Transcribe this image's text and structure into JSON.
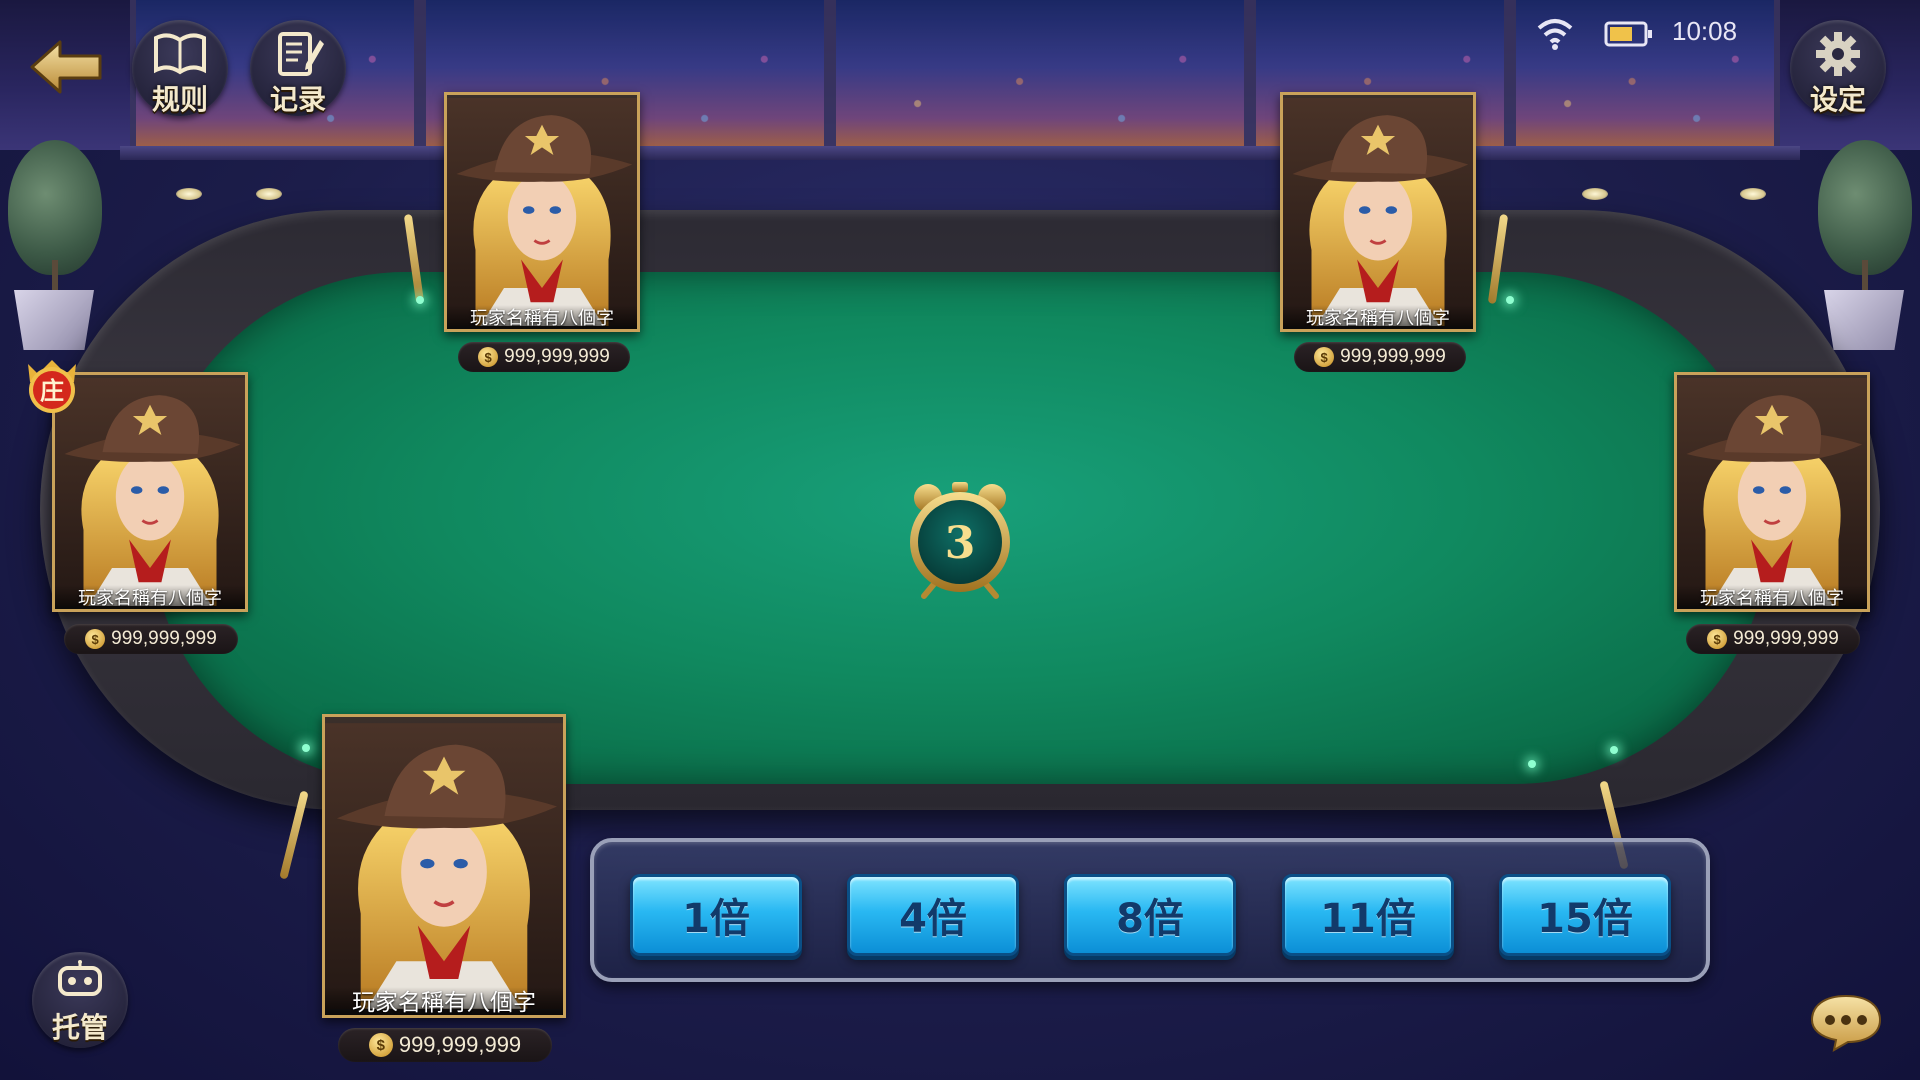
{
  "toolbar": {
    "rules_label": "规则",
    "records_label": "记录",
    "settings_label": "设定"
  },
  "status": {
    "time": "10:08"
  },
  "players": [
    {
      "name": "玩家名稱有八個字",
      "coins": "999,999,999"
    },
    {
      "name": "玩家名稱有八個字",
      "coins": "999,999,999"
    },
    {
      "name": "玩家名稱有八個字",
      "coins": "999,999,999"
    },
    {
      "name": "玩家名稱有八個字",
      "coins": "999,999,999"
    },
    {
      "name": "玩家名稱有八個字",
      "coins": "999,999,999"
    }
  ],
  "dealer_badge": "庄",
  "timer": {
    "countdown": "3"
  },
  "multipliers": [
    "1倍",
    "4倍",
    "8倍",
    "11倍",
    "15倍"
  ],
  "bottom": {
    "auto_label": "托管"
  },
  "colors": {
    "felt": "#10895f",
    "multiplier_button": "#29b8f2",
    "gold": "#c9a25a"
  }
}
